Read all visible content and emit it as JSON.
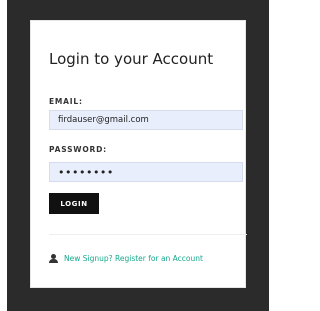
{
  "login": {
    "title": "Login to your Account",
    "email_label": "EMAIL:",
    "email_value": "firdauser@gmail.com",
    "password_label": "PASSWORD:",
    "password_value": "••••••••",
    "login_button": "LOGIN",
    "register_link": "New Signup? Register for an Account",
    "register_icon": "user-icon"
  },
  "colors": {
    "frame": "#2b2b2b",
    "input_background": "#e8eefb",
    "button": "#111111",
    "link": "#17a98c"
  }
}
